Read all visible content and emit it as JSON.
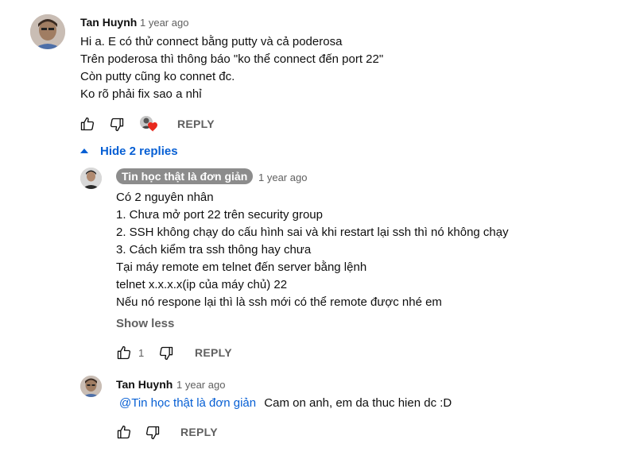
{
  "comment": {
    "author": "Tan Huynh",
    "time": "1 year ago",
    "lines": [
      "Hi a. E có thử connect bằng putty và cả poderosa",
      "Trên poderosa thì thông báo \"ko thể connect đến port 22\"",
      "Còn putty cũng ko connet đc.",
      "Ko rõ phải fix sao a nhỉ"
    ],
    "reply_label": "REPLY"
  },
  "hide_replies_label": "Hide 2 replies",
  "replies": [
    {
      "author": "Tin học thật là đơn giản",
      "time": "1 year ago",
      "lines": [
        "Có 2 nguyên nhân",
        "1. Chưa mở port 22 trên security group",
        "2. SSH không chạy do cấu hình sai và khi restart lại ssh thì nó không chạy",
        "3. Cách kiểm tra ssh thông hay chưa",
        "Tại máy remote em telnet đến server bằng lệnh",
        "telnet x.x.x.x(ip của máy chủ) 22",
        "Nếu nó respone lại thì là ssh mới có thể remote được nhé em"
      ],
      "show_less_label": "Show less",
      "like_count": "1",
      "reply_label": "REPLY"
    },
    {
      "author": "Tan Huynh",
      "time": "1 year ago",
      "mention": "@Tin học thật là đơn giản",
      "text": "Cam on anh, em da thuc hien dc :D",
      "reply_label": "REPLY"
    }
  ],
  "colors": {
    "link": "#065fd4",
    "secondary": "#606060",
    "heart": "#e8291e",
    "author_badge": "#8c8c8c"
  },
  "icons": [
    "thumb-up-icon",
    "thumb-down-icon",
    "heart-icon",
    "caret-up-icon"
  ]
}
